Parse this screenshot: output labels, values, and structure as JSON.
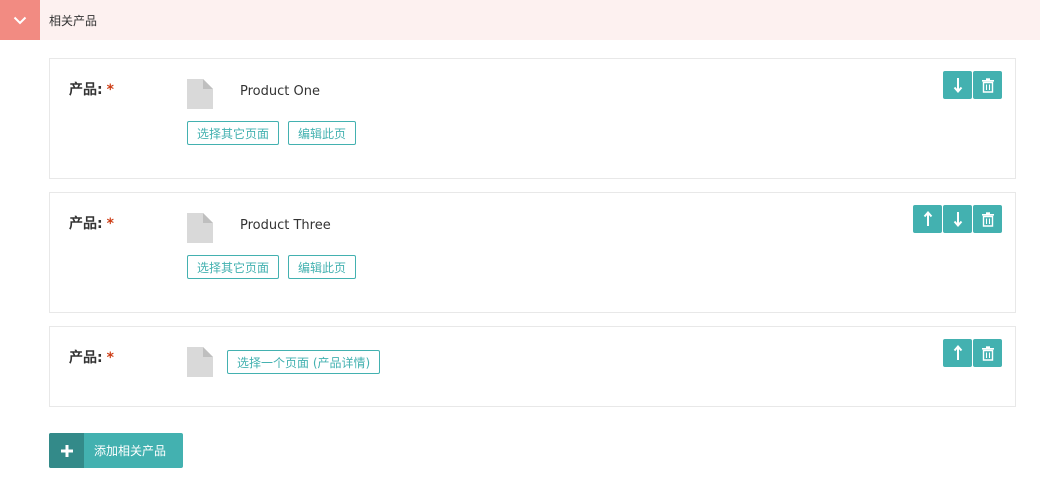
{
  "section": {
    "title": "相关产品",
    "toggle_icon": "chevron-down-icon"
  },
  "products": [
    {
      "label": "产品:",
      "required_mark": "*",
      "title": "Product One",
      "choose_other_label": "选择其它页面",
      "edit_label": "编辑此页"
    },
    {
      "label": "产品:",
      "required_mark": "*",
      "title": "Product Three",
      "choose_other_label": "选择其它页面",
      "edit_label": "编辑此页"
    },
    {
      "label": "产品:",
      "required_mark": "*",
      "choose_page_label": "选择一个页面 (产品详情)"
    }
  ],
  "add_button": {
    "label": "添加相关产品"
  },
  "colors": {
    "accent": "#43b1b0",
    "accent_dark": "#338a89",
    "header_bg": "#fdf1f0",
    "toggle_bg": "#f28b82",
    "required": "#cd3c14"
  }
}
